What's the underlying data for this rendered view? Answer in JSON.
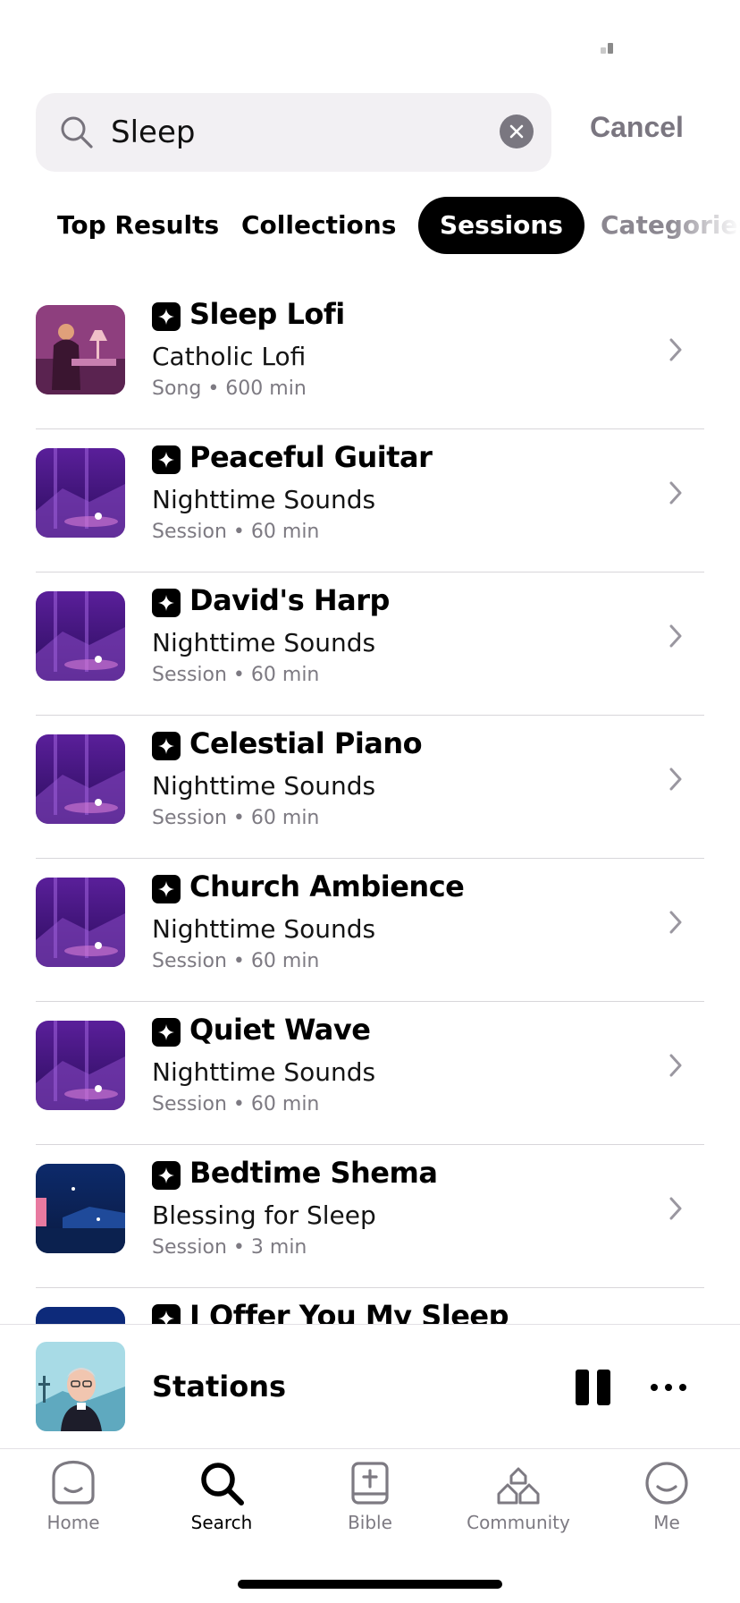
{
  "search": {
    "value": "Sleep",
    "cancel_label": "Cancel"
  },
  "tabs": [
    {
      "label": "Top Results",
      "active": false
    },
    {
      "label": "Collections",
      "active": false
    },
    {
      "label": "Sessions",
      "active": true
    },
    {
      "label": "Categories",
      "active": false
    }
  ],
  "results": [
    {
      "title": "Sleep Lofi",
      "subtitle": "Catholic Lofi",
      "meta": "Song • 600 min",
      "art": "lofi-art"
    },
    {
      "title": "Peaceful Guitar",
      "subtitle": "Nighttime Sounds",
      "meta": "Session • 60 min",
      "art": "night-art"
    },
    {
      "title": "David's Harp",
      "subtitle": "Nighttime Sounds",
      "meta": "Session • 60 min",
      "art": "night-art"
    },
    {
      "title": "Celestial Piano",
      "subtitle": "Nighttime Sounds",
      "meta": "Session • 60 min",
      "art": "night-art"
    },
    {
      "title": "Church Ambience",
      "subtitle": "Nighttime Sounds",
      "meta": "Session • 60 min",
      "art": "night-art"
    },
    {
      "title": "Quiet Wave",
      "subtitle": "Nighttime Sounds",
      "meta": "Session • 60 min",
      "art": "night-art"
    },
    {
      "title": "Bedtime Shema",
      "subtitle": "Blessing for Sleep",
      "meta": "Session • 3 min",
      "art": "shema-art"
    },
    {
      "title": "I Offer You My Sleep",
      "subtitle": "",
      "meta": "",
      "art": "offer-art"
    }
  ],
  "player": {
    "title": "Stations"
  },
  "nav": [
    {
      "label": "Home",
      "icon": "home-icon",
      "active": false
    },
    {
      "label": "Search",
      "icon": "search-icon",
      "active": true
    },
    {
      "label": "Bible",
      "icon": "bible-icon",
      "active": false
    },
    {
      "label": "Community",
      "icon": "community-icon",
      "active": false
    },
    {
      "label": "Me",
      "icon": "me-icon",
      "active": false
    }
  ],
  "colors": {
    "accent": "#000000",
    "muted": "#7d7a82",
    "search_bg": "#f2f0f3"
  }
}
